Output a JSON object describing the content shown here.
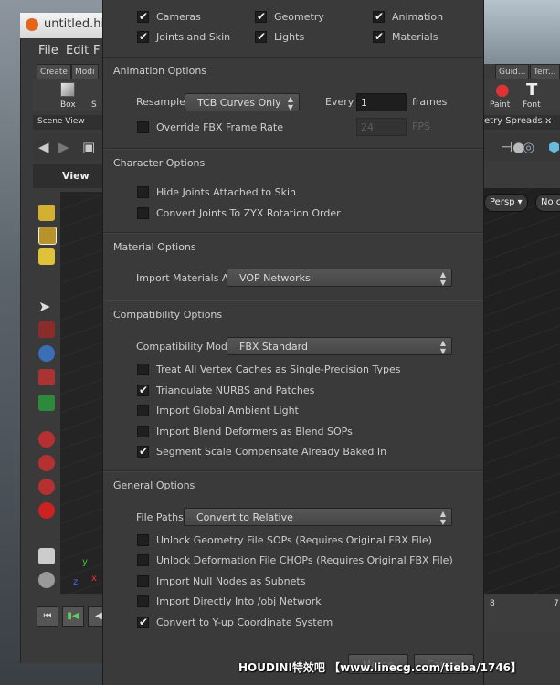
{
  "background": {
    "window_title": "untitled.hi",
    "menu": [
      "File",
      "Edit",
      "F"
    ],
    "shelf_tabs": [
      "Create",
      "Modi"
    ],
    "shelf_tools": [
      "Box",
      "S"
    ],
    "pane_tab": "Scene View",
    "view_label": "View",
    "right_shelf_tabs": [
      "Guid...",
      "Terr..."
    ],
    "right_tools": [
      "Paint",
      "Font"
    ],
    "right_font_icon": "T",
    "right_pane_tab": "etry Spreads...",
    "right_pane_close": "×",
    "right_persp": "Persp ▾",
    "right_nocam": "No c",
    "right_timeline_ticks": [
      "8",
      "7"
    ],
    "axis_x": "x",
    "axis_y": "y",
    "axis_z": "z"
  },
  "dialog": {
    "top_checks": [
      {
        "label": "Cameras",
        "checked": true
      },
      {
        "label": "Geometry",
        "checked": true
      },
      {
        "label": "Animation",
        "checked": true
      },
      {
        "label": "Joints and Skin",
        "checked": true
      },
      {
        "label": "Lights",
        "checked": true
      },
      {
        "label": "Materials",
        "checked": true
      }
    ],
    "animation": {
      "title": "Animation Options",
      "resample_label": "Resample",
      "resample_value": "TCB Curves Only",
      "every_label": "Every",
      "every_value": "1",
      "frames_label": "frames",
      "override_label": "Override FBX Frame Rate",
      "override_checked": false,
      "fps_value": "24",
      "fps_label": "FPS"
    },
    "character": {
      "title": "Character Options",
      "hide_joints": "Hide Joints Attached to Skin",
      "convert_joints": "Convert Joints To ZYX Rotation Order"
    },
    "material": {
      "title": "Material Options",
      "import_label": "Import Materials As",
      "import_value": "VOP Networks"
    },
    "compat": {
      "title": "Compatibility Options",
      "mode_label": "Compatibility Mode",
      "mode_value": "FBX Standard",
      "checks": [
        {
          "label": "Treat All Vertex Caches as Single-Precision Types",
          "checked": false
        },
        {
          "label": "Triangulate NURBS and Patches",
          "checked": true
        },
        {
          "label": "Import Global Ambient Light",
          "checked": false
        },
        {
          "label": "Import Blend Deformers as Blend SOPs",
          "checked": false
        },
        {
          "label": "Segment Scale Compensate Already Baked In",
          "checked": true
        }
      ]
    },
    "general": {
      "title": "General Options",
      "paths_label": "File Paths",
      "paths_value": "Convert to Relative",
      "checks": [
        {
          "label": "Unlock Geometry File SOPs (Requires Original FBX File)",
          "checked": false
        },
        {
          "label": "Unlock Deformation File CHOPs (Requires Original FBX File)",
          "checked": false
        },
        {
          "label": "Import Null Nodes as Subnets",
          "checked": false
        },
        {
          "label": "Import Directly Into /obj Network",
          "checked": false
        },
        {
          "label": "Convert to Y-up Coordinate System",
          "checked": true
        }
      ]
    },
    "buttons": {
      "merge": "Merge",
      "cancel": "Cancel"
    }
  },
  "watermark": "HOUDINI特效吧 【www.linecg.com/tieba/1746】",
  "check_glyph": "✔"
}
